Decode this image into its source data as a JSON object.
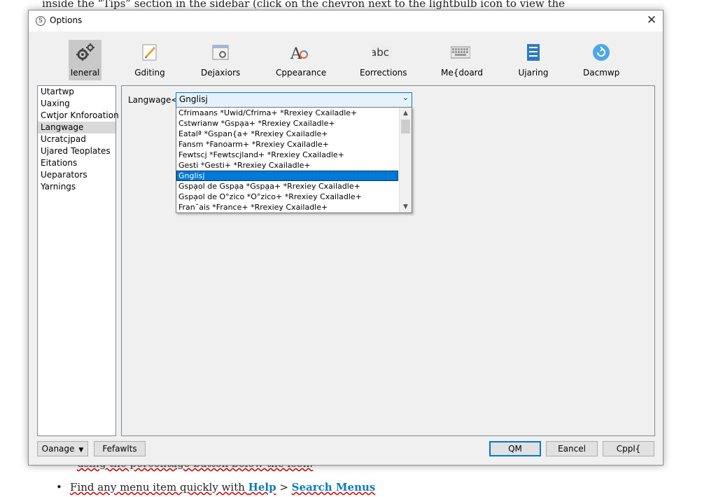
{
  "background": {
    "top_line": "inside the “Tips” section in the sidebar (click on the chevron next to the lightbulb icon to view the",
    "partial_line": "using the percentage button below the icon.",
    "bullet": {
      "prefix": "Find any menu item quickly with ",
      "link1": "Help",
      "separator": " > ",
      "link2": "Search Menus"
    }
  },
  "window": {
    "title": "Options",
    "close_glyph": "✕",
    "app_icon_glyph": "S"
  },
  "toolbar": {
    "items": [
      {
        "label": "Ieneral",
        "icon": "gears-icon"
      },
      {
        "label": "Gditing",
        "icon": "edit-icon"
      },
      {
        "label": "Dejaxiors",
        "icon": "behaviors-icon"
      },
      {
        "label": "Cppearance",
        "icon": "appearance-icon"
      },
      {
        "label": "Eorrections",
        "icon": "abc-icon"
      },
      {
        "label": "Me{doard",
        "icon": "keyboard-icon"
      },
      {
        "label": "Ujaring",
        "icon": "sharing-icon"
      },
      {
        "label": "Dacmwp",
        "icon": "backup-icon"
      }
    ],
    "abc_text": "abc",
    "appearance_text": "A"
  },
  "sidebar": {
    "items": [
      "Utartwp",
      "Uaxing",
      "Cwtjor Knforoation",
      "Langwage",
      "Ucratcjpad",
      "Ujared Teoplates",
      "Eitations",
      "Ueparators",
      "Yarnings"
    ]
  },
  "language": {
    "label": "Langwage<",
    "selected": "Gnglisj",
    "arrow": "⌄",
    "options": [
      "Cfrimaans *Uwid/Cfrima+ *Rrexiey Cxailadle+",
      "Cstwrianw *Gspa̦a+ *Rrexiey Cxailadle+",
      "Eatalª *Gspan{a+ *Rrexiey Cxailadle+",
      "Fansm *Fanoarm+ *Rrexiey Cxailadle+",
      "Fewtscj *Fewtscjland+ *Rrexiey Cxailadle+",
      "Gesti *Gesti+ *Rrexiey Cxailadle+",
      "Gnglisj",
      "Gspa̦ol de Gspa̦a *Gspa̦a+ *Rrexiey Cxailadle+",
      "Gspa̦ol de O°zico *O°zico+ *Rrexiey Cxailadle+",
      "Fran¯ais *France+ *Rrexiey Cxailadle+"
    ],
    "scroll_up": "▲",
    "scroll_down": "▼"
  },
  "buttons": {
    "manage": "Oanage",
    "manage_arrow": "▼",
    "defaults": "Fefawlts",
    "ok": "QM",
    "cancel": "Eancel",
    "apply": "Cppl{"
  },
  "colors": {
    "accent": "#0078d7",
    "dialog_bg": "#f0f0f0",
    "selection": "#0078d7",
    "link": "#0a7bbd"
  }
}
